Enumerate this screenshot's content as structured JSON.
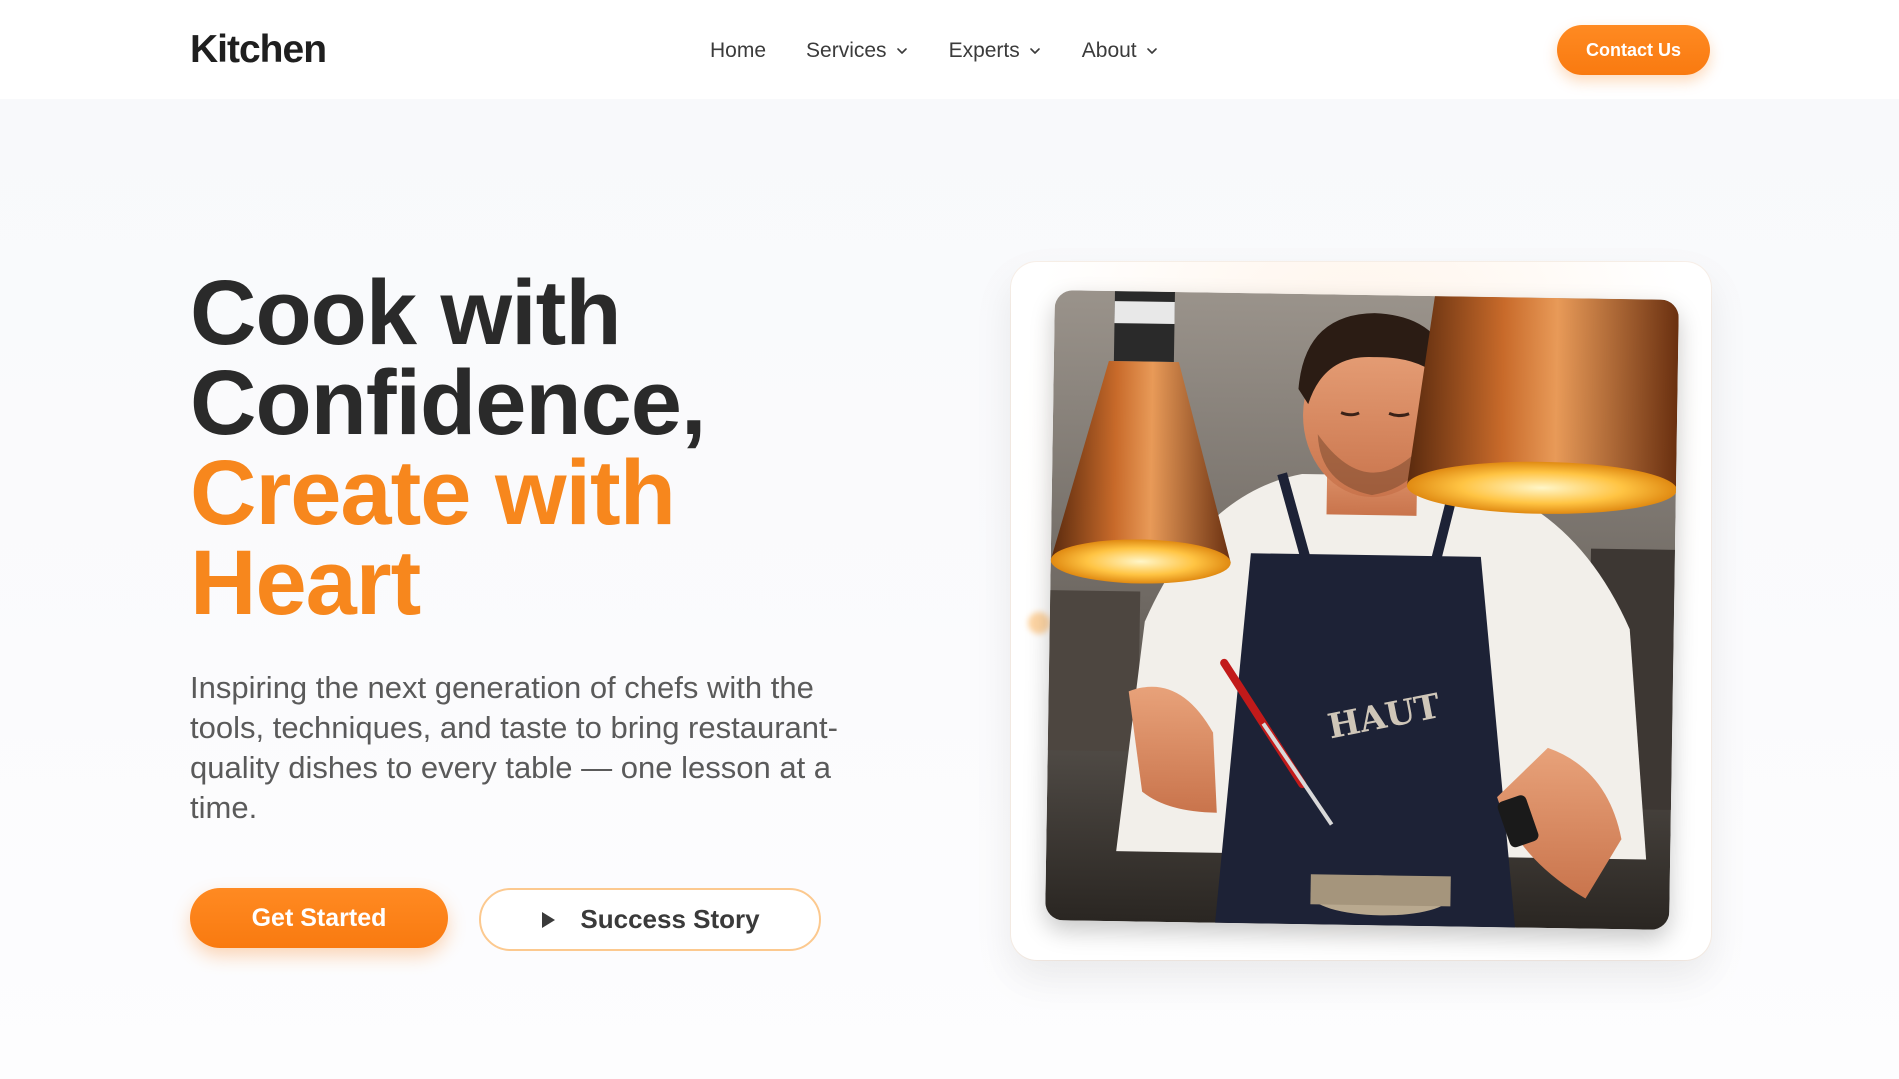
{
  "header": {
    "logo": "Kitchen",
    "nav": [
      {
        "label": "Home",
        "has_dropdown": false
      },
      {
        "label": "Services",
        "has_dropdown": true
      },
      {
        "label": "Experts",
        "has_dropdown": true
      },
      {
        "label": "About",
        "has_dropdown": true
      }
    ],
    "contact_label": "Contact Us"
  },
  "hero": {
    "headline_line1": "Cook with",
    "headline_line2": "Confidence,",
    "headline_line3": "Create with",
    "headline_line4": "Heart",
    "subtext": "Inspiring the next generation of chefs with the tools, techniques, and taste to bring restaurant-quality dishes to every table — one lesson at a time.",
    "primary_cta": "Get Started",
    "secondary_cta": "Success Story"
  },
  "colors": {
    "accent": "#f7871d",
    "text_dark": "#2a2a2a",
    "text_muted": "#5a5a5a"
  },
  "icons": {
    "dropdown": "chevron-down-icon",
    "play": "play-icon"
  }
}
